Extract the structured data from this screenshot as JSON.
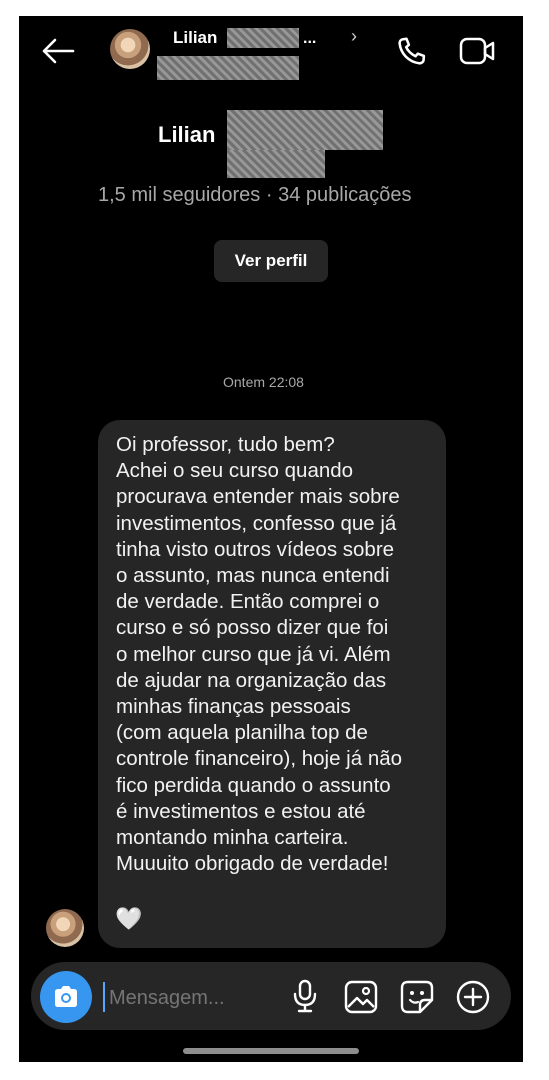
{
  "header": {
    "name": "Lilian",
    "ellipsis": "...",
    "chevron": "›",
    "back_icon": "arrow-left-icon",
    "call_icon": "phone-icon",
    "video_icon": "video-camera-icon"
  },
  "profile": {
    "name": "Lilian",
    "stats": "1,5 mil seguidores · 34 publicações",
    "view_profile_label": "Ver perfil"
  },
  "thread": {
    "timestamp": "Ontem 22:08",
    "message": "Oi professor, tudo bem?\nAchei o seu curso quando\nprocurava entender mais sobre\ninvestimentos, confesso que já\ntinha visto outros vídeos sobre\no assunto, mas nunca entendi\nde verdade. Então comprei o\ncurso e só posso dizer que foi\no melhor curso que já vi. Além\nde ajudar na organização das\nminhas finanças pessoais\n(com aquela planilha top de\ncontrole financeiro), hoje já não\nfico perdida quando o assunto\né investimentos e estou até\nmontando minha carteira.\nMuuuito obrigado de verdade!",
    "emoji": "🤍"
  },
  "composer": {
    "placeholder": "Mensagem...",
    "icons": [
      "camera-icon",
      "microphone-icon",
      "gallery-icon",
      "sticker-icon",
      "plus-circle-icon"
    ]
  },
  "colors": {
    "background": "#000000",
    "bubble": "#262626",
    "accent": "#3797f0",
    "muted_text": "#a8a8a8"
  }
}
